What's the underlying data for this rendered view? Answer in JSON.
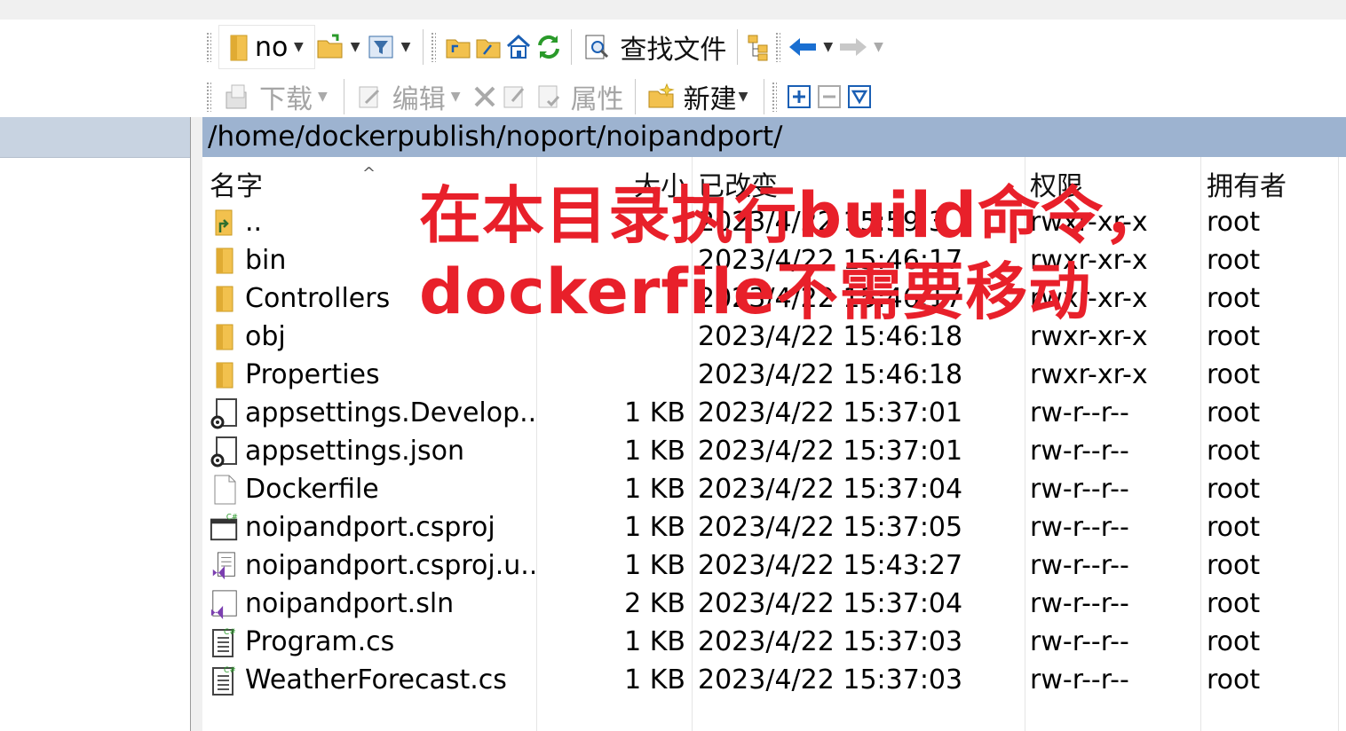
{
  "toolbar_row1": {
    "drive_label": "no",
    "find_files_label": "查找文件"
  },
  "toolbar_row2": {
    "download_label": "下载",
    "edit_label": "编辑",
    "properties_label": "属性",
    "new_label": "新建"
  },
  "path": "/home/dockerpublish/noport/noipandport/",
  "columns": {
    "name": "名字",
    "size": "大小",
    "changed": "已改变",
    "rights": "权限",
    "owner": "拥有者"
  },
  "files": [
    {
      "name": "..",
      "size": "",
      "changed": "2023/4/22 15:59:3",
      "rights": "rwxr-xr-x",
      "owner": "root",
      "icon": "parent-folder-icon"
    },
    {
      "name": "bin",
      "size": "",
      "changed": "2023/4/22 15:46:17",
      "rights": "rwxr-xr-x",
      "owner": "root",
      "icon": "folder-icon"
    },
    {
      "name": "Controllers",
      "size": "",
      "changed": "2023/4/22 15:46:17",
      "rights": "rwxr-xr-x",
      "owner": "root",
      "icon": "folder-icon"
    },
    {
      "name": "obj",
      "size": "",
      "changed": "2023/4/22 15:46:18",
      "rights": "rwxr-xr-x",
      "owner": "root",
      "icon": "folder-icon"
    },
    {
      "name": "Properties",
      "size": "",
      "changed": "2023/4/22 15:46:18",
      "rights": "rwxr-xr-x",
      "owner": "root",
      "icon": "folder-icon"
    },
    {
      "name": "appsettings.Develop...",
      "size": "1 KB",
      "changed": "2023/4/22 15:37:01",
      "rights": "rw-r--r--",
      "owner": "root",
      "icon": "json-file-icon"
    },
    {
      "name": "appsettings.json",
      "size": "1 KB",
      "changed": "2023/4/22 15:37:01",
      "rights": "rw-r--r--",
      "owner": "root",
      "icon": "json-file-icon"
    },
    {
      "name": "Dockerfile",
      "size": "1 KB",
      "changed": "2023/4/22 15:37:04",
      "rights": "rw-r--r--",
      "owner": "root",
      "icon": "blank-file-icon"
    },
    {
      "name": "noipandport.csproj",
      "size": "1 KB",
      "changed": "2023/4/22 15:37:05",
      "rights": "rw-r--r--",
      "owner": "root",
      "icon": "csproj-file-icon"
    },
    {
      "name": "noipandport.csproj.u...",
      "size": "1 KB",
      "changed": "2023/4/22 15:43:27",
      "rights": "rw-r--r--",
      "owner": "root",
      "icon": "vs-user-file-icon"
    },
    {
      "name": "noipandport.sln",
      "size": "2 KB",
      "changed": "2023/4/22 15:37:04",
      "rights": "rw-r--r--",
      "owner": "root",
      "icon": "vs-solution-file-icon"
    },
    {
      "name": "Program.cs",
      "size": "1 KB",
      "changed": "2023/4/22 15:37:03",
      "rights": "rw-r--r--",
      "owner": "root",
      "icon": "csharp-file-icon"
    },
    {
      "name": "WeatherForecast.cs",
      "size": "1 KB",
      "changed": "2023/4/22 15:37:03",
      "rights": "rw-r--r--",
      "owner": "root",
      "icon": "csharp-file-icon"
    }
  ],
  "annotation": {
    "line1": "在本目录执行build命令，",
    "line2": "dockerfile不需要移动",
    "color": "#e8202a"
  },
  "colors": {
    "path_bar": "#9db3d0",
    "left_header": "#c8d3e1",
    "folder": "#f2c14e"
  }
}
